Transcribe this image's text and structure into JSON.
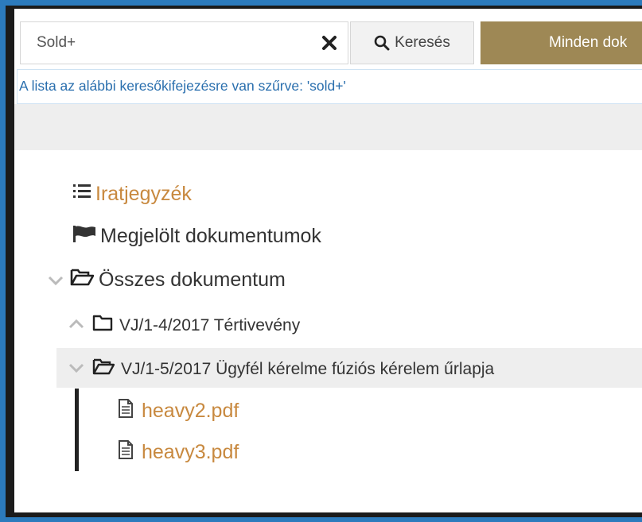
{
  "search": {
    "value": "Sold+",
    "button_label": "Keresés"
  },
  "all_documents_button": "Minden dok",
  "filter_notice": "A lista az alábbi keresőkifejezésre van szűrve: 'sold+'",
  "tree": {
    "index": "Iratjegyzék",
    "marked": "Megjelölt dokumentumok",
    "all_documents": "Összes dokumentum",
    "folders": [
      {
        "label": "VJ/1-4/2017 Tértivevény",
        "expanded": false
      },
      {
        "label": "VJ/1-5/2017 Ügyfél kérelme fúziós kérelem űrlapja",
        "expanded": true,
        "files": [
          "heavy2.pdf",
          "heavy3.pdf"
        ]
      }
    ]
  },
  "colors": {
    "frame_blue": "#2c7bbd",
    "accent_gold": "#9e8855",
    "link_gold": "#c8893f",
    "notice_blue": "#2a6fae"
  },
  "icons": {
    "clear": "close-icon",
    "search": "search-icon",
    "index": "list-icon",
    "marked": "flag-icon",
    "folder_open": "folder-open-icon",
    "folder": "folder-icon",
    "file": "file-icon"
  }
}
